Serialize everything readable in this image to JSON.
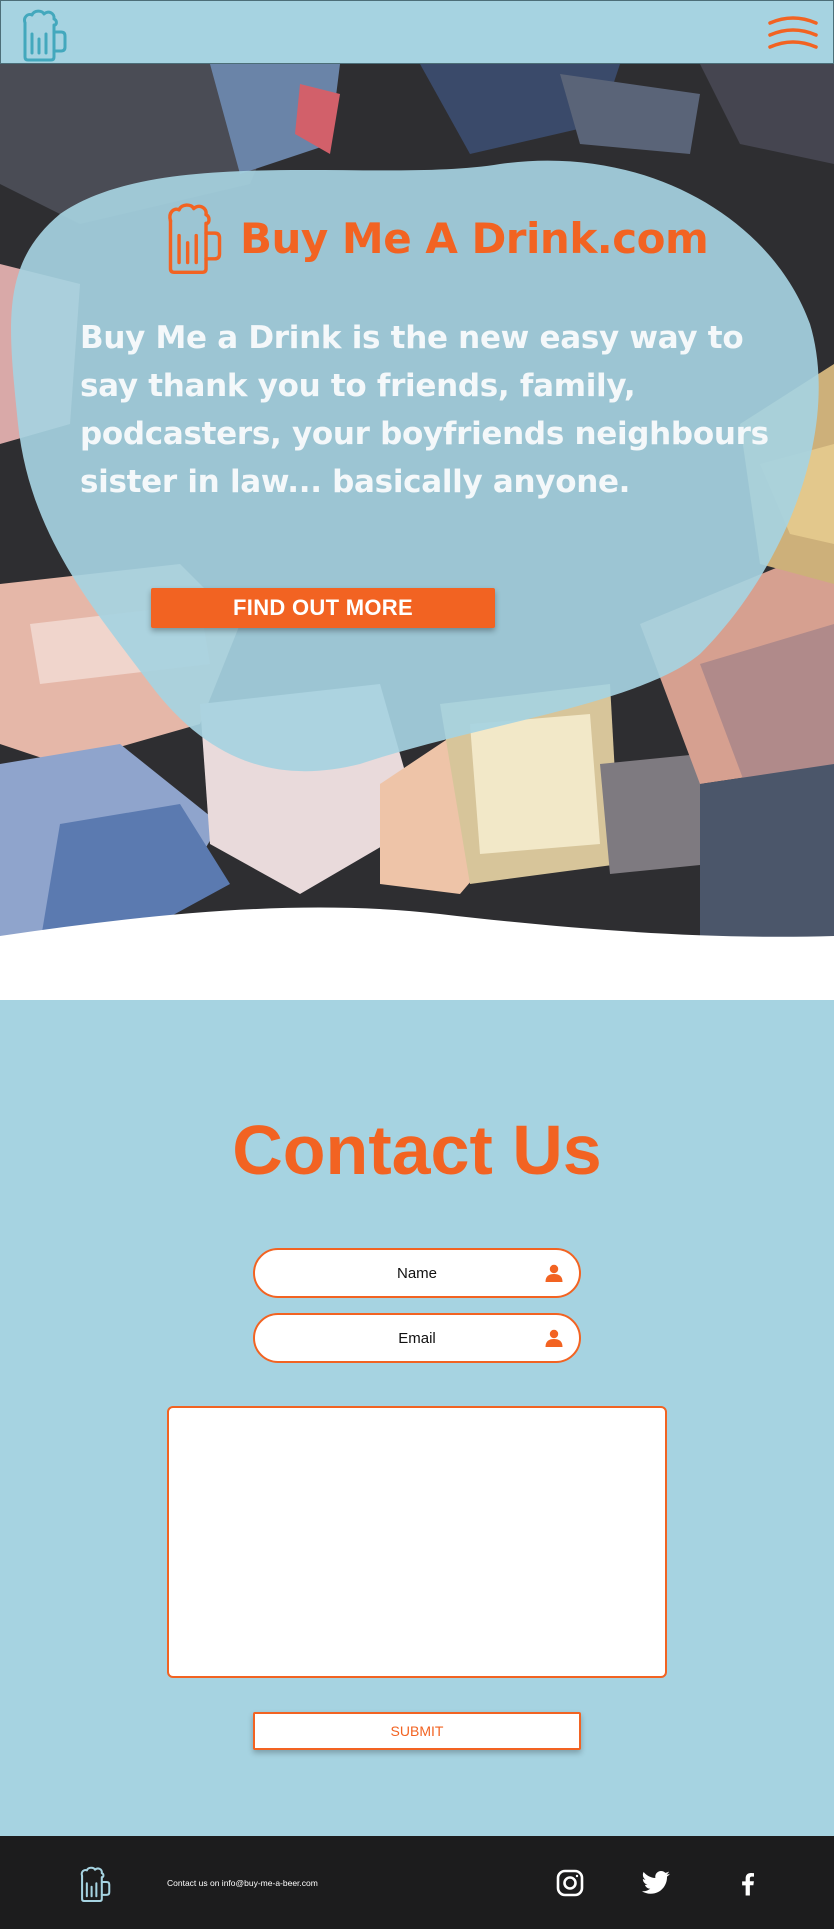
{
  "nav": {
    "logo_icon": "beer-mug-icon",
    "menu_icon": "hamburger-menu-icon",
    "logo_color": "#43a8bd",
    "menu_color": "#f26322"
  },
  "hero": {
    "title": "Buy Me A Drink.com",
    "title_icon": "beer-mug-icon",
    "description": "Buy Me a Drink is the new easy way to say thank you to friends, family, podcasters, your boyfriends neighbours sister in law... basically anyone.",
    "cta_label": "FIND OUT MORE"
  },
  "contact": {
    "title": "Contact Us",
    "name_placeholder": "Name",
    "email_placeholder": "Email",
    "field_icon": "person-icon",
    "message_placeholder": "",
    "submit_label": "SUBMIT"
  },
  "footer": {
    "logo_icon": "beer-mug-icon",
    "contact_text": "Contact us on info@buy-me-a-beer.com",
    "social": [
      "instagram-icon",
      "twitter-icon",
      "facebook-icon"
    ]
  },
  "colors": {
    "accent": "#f26322",
    "light_blue": "#a6d3e1",
    "footer_bg": "#1c1c1d",
    "text_light": "#f4f8fa"
  }
}
